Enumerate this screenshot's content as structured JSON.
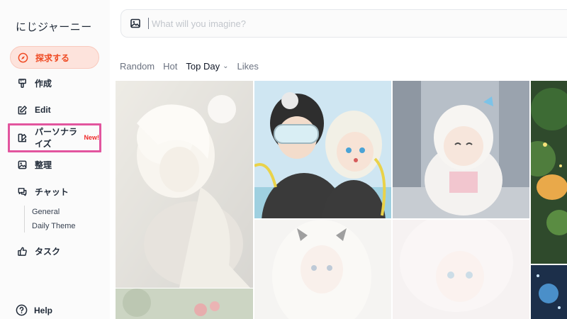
{
  "app": {
    "title": "にじジャーニー"
  },
  "sidebar": {
    "items": [
      {
        "label": "探求する",
        "icon": "compass-icon",
        "active": true
      },
      {
        "label": "作成",
        "icon": "brush-icon"
      },
      {
        "label": "Edit",
        "icon": "edit-icon"
      },
      {
        "label": "パーソナライズ",
        "icon": "palette-icon",
        "badge": "New!"
      },
      {
        "label": "整理",
        "icon": "image-icon"
      },
      {
        "label": "チャット",
        "icon": "chat-icon",
        "children": [
          "General",
          "Daily Theme"
        ]
      },
      {
        "label": "タスク",
        "icon": "thumbs-up-icon"
      }
    ],
    "help": {
      "label": "Help",
      "icon": "help-icon"
    }
  },
  "search": {
    "placeholder": "What will you imagine?",
    "icon": "image-icon"
  },
  "filters": [
    {
      "label": "Random"
    },
    {
      "label": "Hot"
    },
    {
      "label": "Top Day",
      "selected": true,
      "icon": "chevron-down-icon"
    },
    {
      "label": "Likes"
    }
  ],
  "colors": {
    "accent": "#ef4a23",
    "active_bg": "#fde3dc",
    "highlight": "#e2559e",
    "badge": "#ef2a2a"
  }
}
